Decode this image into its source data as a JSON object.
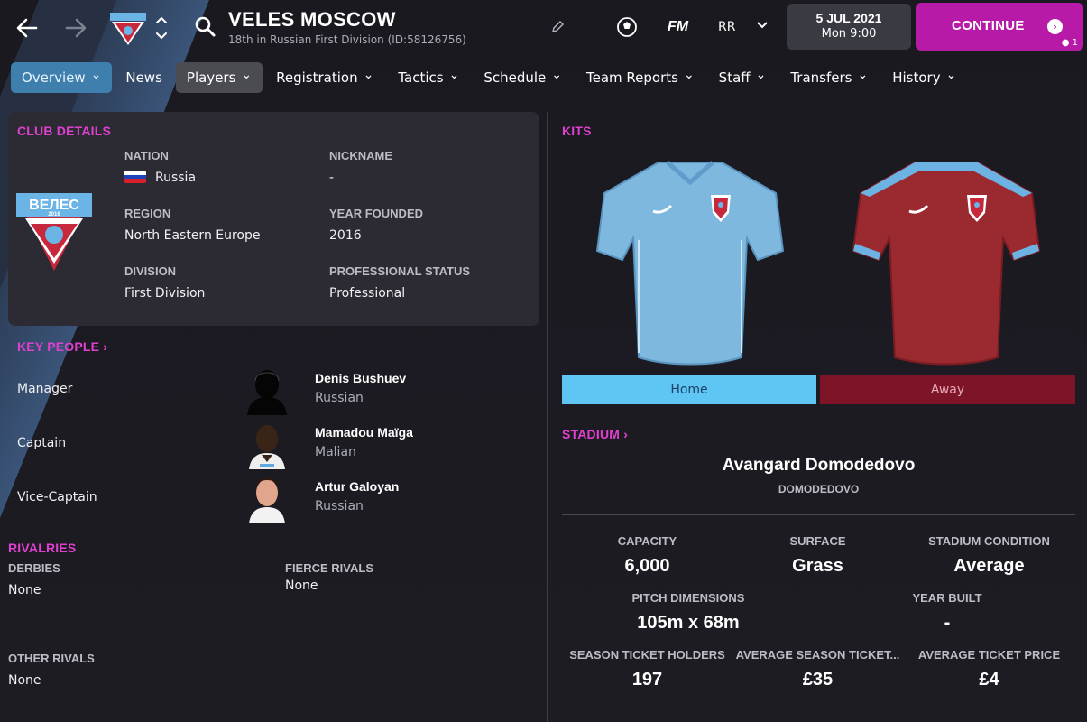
{
  "header": {
    "club_name": "VELES MOSCOW",
    "club_subtitle": "18th in Russian First Division (ID:58126756)",
    "fm_logo": "FM",
    "profile_initials": "RR",
    "date_main": "5 JUL 2021",
    "date_sub": "Mon 9:00",
    "continue_label": "CONTINUE",
    "continue_count": "1"
  },
  "tabs": [
    {
      "label": "Overview",
      "state": "active"
    },
    {
      "label": "News",
      "state": "normal"
    },
    {
      "label": "Players",
      "state": "hover"
    },
    {
      "label": "Registration",
      "state": "normal"
    },
    {
      "label": "Tactics",
      "state": "normal"
    },
    {
      "label": "Schedule",
      "state": "normal"
    },
    {
      "label": "Team Reports",
      "state": "normal"
    },
    {
      "label": "Staff",
      "state": "normal"
    },
    {
      "label": "Transfers",
      "state": "normal"
    },
    {
      "label": "History",
      "state": "normal"
    }
  ],
  "club_details": {
    "title": "CLUB DETAILS",
    "badge_text": "ВЕЛЕС",
    "badge_year": "2016",
    "nation_label": "NATION",
    "nation_value": "Russia",
    "nickname_label": "NICKNAME",
    "nickname_value": "-",
    "region_label": "REGION",
    "region_value": "North Eastern Europe",
    "year_founded_label": "YEAR FOUNDED",
    "year_founded_value": "2016",
    "division_label": "DIVISION",
    "division_value": "First Division",
    "pro_status_label": "PROFESSIONAL STATUS",
    "pro_status_value": "Professional"
  },
  "key_people": {
    "title": "KEY PEOPLE",
    "people": [
      {
        "role": "Manager",
        "name": "Denis Bushuev",
        "nationality": "Russian"
      },
      {
        "role": "Captain",
        "name": "Mamadou Maïga",
        "nationality": "Malian"
      },
      {
        "role": "Vice-Captain",
        "name": "Artur Galoyan",
        "nationality": "Russian"
      }
    ]
  },
  "rivalries": {
    "title": "RIVALRIES",
    "derbies_label": "DERBIES",
    "derbies_value": "None",
    "fierce_label": "FIERCE RIVALS",
    "fierce_value": "None",
    "other_label": "OTHER RIVALS",
    "other_value": "None"
  },
  "kits": {
    "title": "KITS",
    "home_label": "Home",
    "away_label": "Away",
    "home_color": "#7fb8de",
    "away_color": "#9a2a30"
  },
  "stadium": {
    "title": "STADIUM",
    "name": "Avangard Domodedovo",
    "city": "DOMODEDOVO",
    "capacity_label": "CAPACITY",
    "capacity_value": "6,000",
    "surface_label": "SURFACE",
    "surface_value": "Grass",
    "condition_label": "STADIUM CONDITION",
    "condition_value": "Average",
    "pitch_label": "PITCH DIMENSIONS",
    "pitch_value": "105m x 68m",
    "year_built_label": "YEAR BUILT",
    "year_built_value": "-",
    "season_holders_label": "SEASON TICKET HOLDERS",
    "season_holders_value": "197",
    "avg_season_label": "AVERAGE SEASON TICKET...",
    "avg_season_value": "£35",
    "avg_ticket_label": "AVERAGE TICKET PRICE",
    "avg_ticket_value": "£4"
  },
  "colors": {
    "accent_magenta": "#e040d0",
    "continue_bg": "#b81aa8",
    "active_tab": "#3f7fae"
  }
}
